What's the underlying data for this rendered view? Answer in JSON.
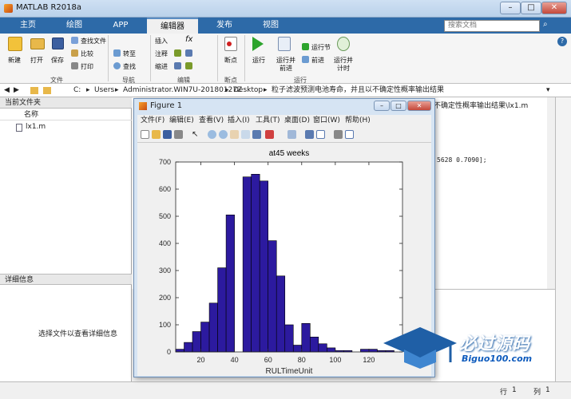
{
  "window": {
    "title": "MATLAB R2018a"
  },
  "tabs": [
    {
      "label": "主页"
    },
    {
      "label": "绘图"
    },
    {
      "label": "APP"
    },
    {
      "label": "编辑器"
    },
    {
      "label": "发布"
    },
    {
      "label": "视图"
    }
  ],
  "search": {
    "placeholder": "搜索文档"
  },
  "ribbon": {
    "file": {
      "new": "新建",
      "open": "打开",
      "save": "保存",
      "find_files": "查找文件",
      "compare": "比较",
      "print": "打印",
      "group": "文件"
    },
    "nav": {
      "goto": "转至",
      "find": "查找",
      "group": "导航"
    },
    "edit": {
      "insert": "插入",
      "comment": "注释",
      "indent": "缩进",
      "fx": "fx",
      "group": "编辑"
    },
    "breakpoints": {
      "label": "断点",
      "group": "断点"
    },
    "run": {
      "run": "运行",
      "run_advance_1": "运行并",
      "run_advance_2": "前进",
      "run_section": "运行节",
      "advance": "前进",
      "run_time_1": "运行并",
      "run_time_2": "计时",
      "group": "运行"
    }
  },
  "address": {
    "path": [
      "C:",
      "Users",
      "Administrator.WIN7U-20180127Z",
      "Desktop",
      "粒子滤波预测电池寿命，并且以不确定性概率输出结果"
    ]
  },
  "current_folder": {
    "title": "当前文件夹",
    "col_name": "名称",
    "files": [
      "lx1.m"
    ]
  },
  "detail": {
    "title": "详细信息",
    "hint": "选择文件以查看详细信息"
  },
  "editor": {
    "path_tail": "不确定性概率输出结果\\lx1.m",
    "code_fragment": "5628 0.7090];"
  },
  "figure": {
    "title": "Figure 1",
    "menu": [
      "文件(F)",
      "编辑(E)",
      "查看(V)",
      "插入(I)",
      "工具(T)",
      "桌面(D)",
      "窗口(W)",
      "帮助(H)"
    ]
  },
  "status": {
    "row_label": "行",
    "row": "1",
    "col_label": "列",
    "col": "1"
  },
  "watermark": {
    "text": "必过源码",
    "url": "Biguo100.com"
  },
  "chart_data": {
    "type": "bar",
    "title": "at45 weeks",
    "xlabel": "RULTimeUnit",
    "ylabel": "",
    "xlim": [
      5,
      140
    ],
    "ylim": [
      0,
      700
    ],
    "xticks": [
      20,
      40,
      60,
      80,
      100,
      120
    ],
    "yticks": [
      0,
      100,
      200,
      300,
      400,
      500,
      600,
      700
    ],
    "bar_color": "#2c1a9f",
    "bin_width": 5,
    "bin_centers": [
      7.5,
      12.5,
      17.5,
      22.5,
      27.5,
      32.5,
      37.5,
      42.5,
      47.5,
      52.5,
      57.5,
      62.5,
      67.5,
      72.5,
      77.5,
      82.5,
      87.5,
      92.5,
      97.5,
      102.5,
      107.5,
      112.5,
      117.5,
      122.5,
      127.5,
      132.5,
      137.5
    ],
    "values": [
      10,
      35,
      75,
      110,
      180,
      310,
      505,
      0,
      645,
      655,
      630,
      410,
      280,
      100,
      25,
      105,
      55,
      30,
      15,
      5,
      5,
      0,
      10,
      10,
      5,
      5,
      0
    ]
  }
}
